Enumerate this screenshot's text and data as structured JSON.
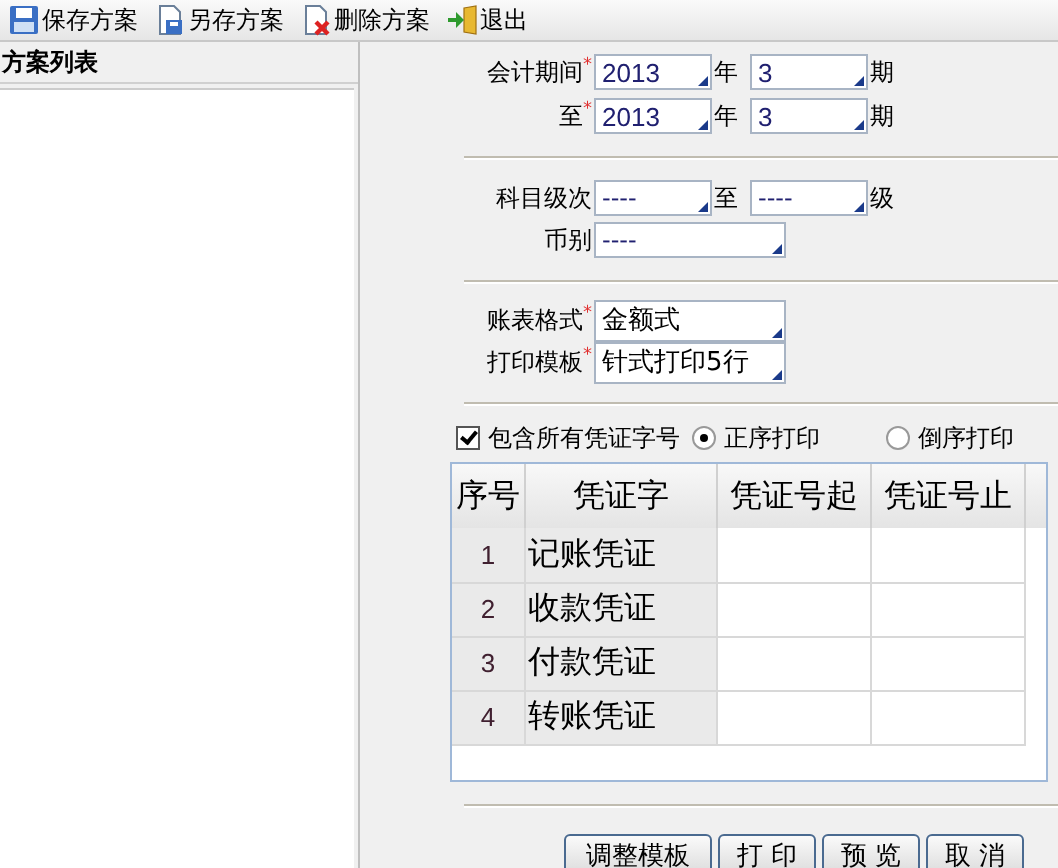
{
  "toolbar": [
    {
      "label": "保存方案",
      "kind": "save"
    },
    {
      "label": "另存方案",
      "kind": "saveas"
    },
    {
      "label": "删除方案",
      "kind": "delete"
    },
    {
      "label": "退出",
      "kind": "exit"
    }
  ],
  "sidebar": {
    "title": "方案列表"
  },
  "period": {
    "label": "会计期间",
    "required_mark": "*",
    "year": "2013",
    "year_unit": "年",
    "period": "3",
    "period_unit": "期"
  },
  "period_to": {
    "label": "至",
    "required_mark": "*",
    "year": "2013",
    "year_unit": "年",
    "period": "3",
    "period_unit": "期"
  },
  "level": {
    "label": "科目级次",
    "from": "----",
    "to_label": "至",
    "to": "----",
    "unit": "级"
  },
  "currency": {
    "label": "币别",
    "value": "----"
  },
  "format": {
    "label": "账表格式",
    "required_mark": "*",
    "value": "金额式"
  },
  "template": {
    "label": "打印模板",
    "required_mark": "*",
    "value": "针式打印5行"
  },
  "include_all": {
    "label": "包含所有凭证字号",
    "checked": true
  },
  "order": [
    {
      "label": "正序打印",
      "selected": true
    },
    {
      "label": "倒序打印",
      "selected": false
    }
  ],
  "table": {
    "columns": [
      "序号",
      "凭证字",
      "凭证号起",
      "凭证号止"
    ],
    "rows": [
      [
        "1",
        "记账凭证",
        "",
        ""
      ],
      [
        "2",
        "收款凭证",
        "",
        ""
      ],
      [
        "3",
        "付款凭证",
        "",
        ""
      ],
      [
        "4",
        "转账凭证",
        "",
        ""
      ]
    ]
  },
  "buttons": [
    "调整模板",
    "打 印",
    "预 览",
    "取 消"
  ]
}
